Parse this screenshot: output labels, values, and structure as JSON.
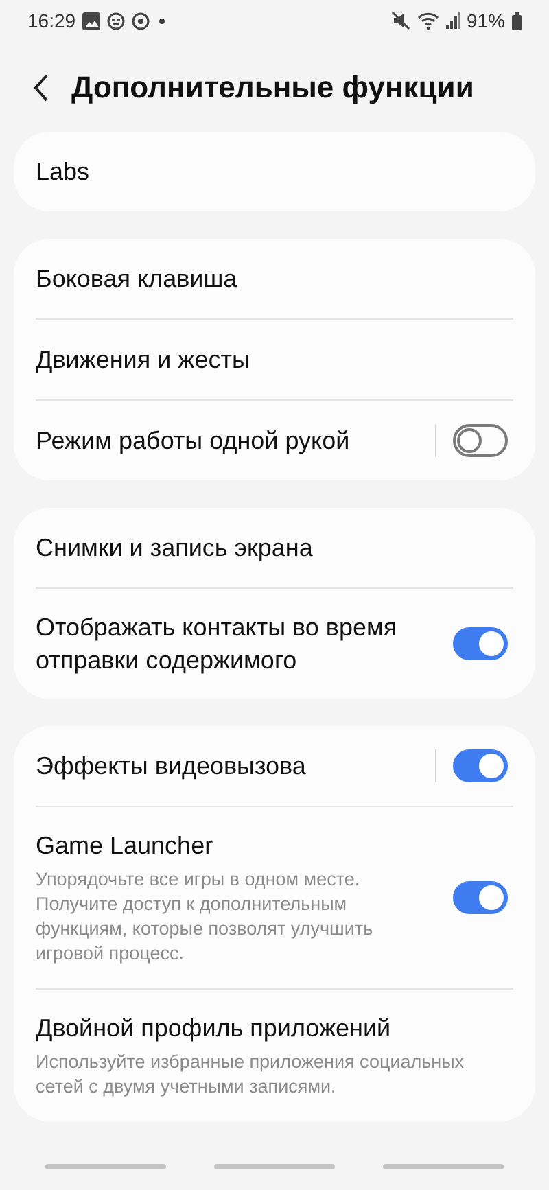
{
  "status_bar": {
    "time": "16:29",
    "battery": "91%"
  },
  "header": {
    "title": "Дополнительные функции"
  },
  "groups": [
    {
      "rows": [
        {
          "kind": "plain",
          "title": "Labs"
        }
      ]
    },
    {
      "rows": [
        {
          "kind": "plain",
          "title": "Боковая клавиша"
        },
        {
          "kind": "plain",
          "title": "Движения и жесты"
        },
        {
          "kind": "toggle",
          "title": "Режим работы одной рукой",
          "on": false,
          "separator": true
        }
      ]
    },
    {
      "rows": [
        {
          "kind": "plain",
          "title": "Снимки и запись экрана"
        },
        {
          "kind": "toggle",
          "title": "Отображать контакты во время отправки содержимого",
          "on": true,
          "separator": false
        }
      ]
    },
    {
      "rows": [
        {
          "kind": "toggle",
          "title": "Эффекты видеовызова",
          "on": true,
          "separator": true
        },
        {
          "kind": "toggle",
          "title": "Game Launcher",
          "subtitle": "Упорядочьте все игры в одном месте. Получите доступ к дополнительным функциям, которые позволят улучшить игровой процесс.",
          "on": true,
          "separator": false
        },
        {
          "kind": "plain",
          "title": "Двойной профиль приложений",
          "subtitle": "Используйте избранные приложения социальных сетей с двумя учетными записями."
        }
      ]
    }
  ]
}
